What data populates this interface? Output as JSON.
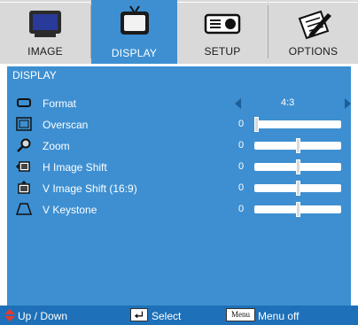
{
  "tabs": [
    {
      "label": "IMAGE",
      "icon": "monitor-icon",
      "active": false
    },
    {
      "label": "DISPLAY",
      "icon": "tv-icon",
      "active": true
    },
    {
      "label": "SETUP",
      "icon": "projector-icon",
      "active": false
    },
    {
      "label": "OPTIONS",
      "icon": "notepad-pencil-icon",
      "active": false
    }
  ],
  "section": {
    "title": "DISPLAY"
  },
  "rows": [
    {
      "label": "Format",
      "icon": "format-icon",
      "value": "4:3",
      "type": "choice"
    },
    {
      "label": "Overscan",
      "icon": "overscan-icon",
      "value": "0",
      "type": "slider",
      "level": 0.0
    },
    {
      "label": "Zoom",
      "icon": "zoom-icon",
      "value": "0",
      "type": "slider",
      "level": 0.5
    },
    {
      "label": "H Image Shift",
      "icon": "h-image-shift-icon",
      "value": "0",
      "type": "slider",
      "level": 0.5
    },
    {
      "label": "V Image Shift (16:9)",
      "icon": "v-image-shift-icon",
      "value": "0",
      "type": "slider",
      "level": 0.5
    },
    {
      "label": "V Keystone",
      "icon": "keystone-icon",
      "value": "0",
      "type": "slider",
      "level": 0.5
    }
  ],
  "footer": {
    "updown": "Up / Down",
    "select": "Select",
    "menu_key": "Menu",
    "menuoff": "Menu off"
  },
  "colors": {
    "accent": "#3d8fd1",
    "footer": "#1e70b8",
    "tabbar": "#d9d9d9"
  }
}
